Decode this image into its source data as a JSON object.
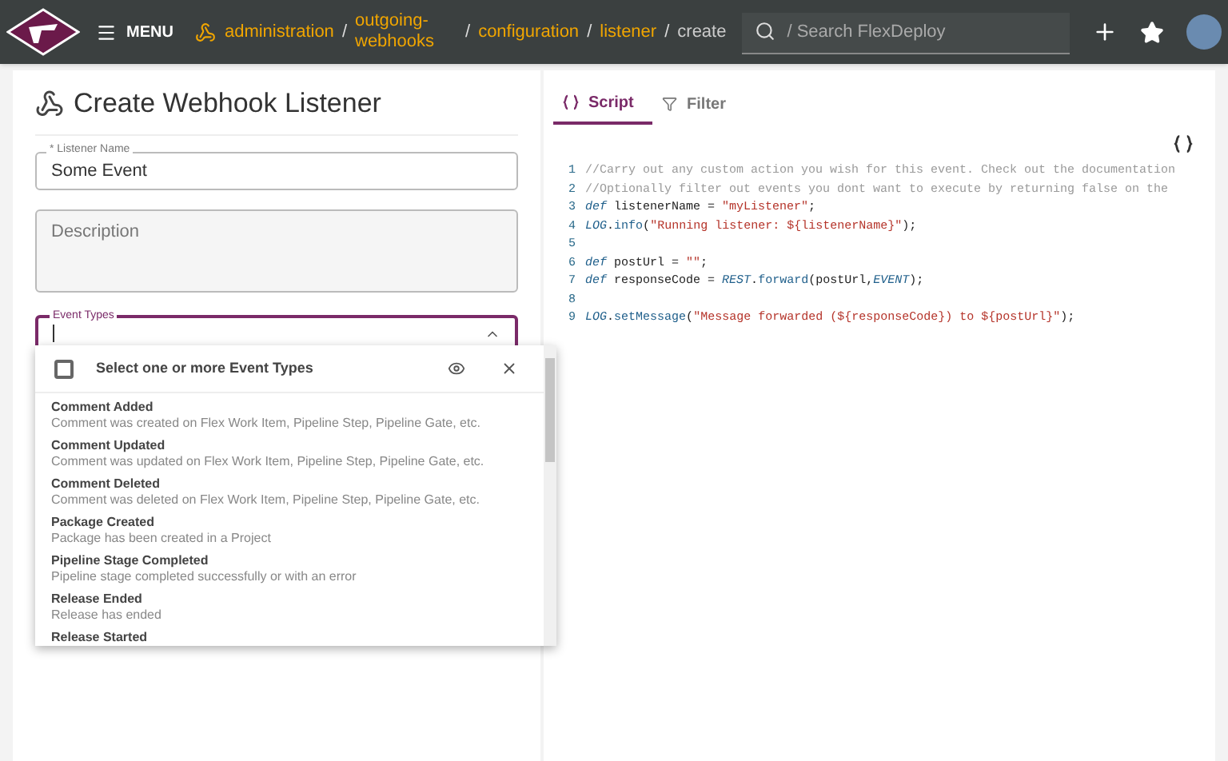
{
  "topbar": {
    "menu_label": "MENU",
    "separator": "/",
    "breadcrumbs": [
      {
        "label": "administration",
        "link": true
      },
      {
        "label": "outgoing-webhooks",
        "link": true
      },
      {
        "label": "configuration",
        "link": true
      },
      {
        "label": "listener",
        "link": true
      },
      {
        "label": "create",
        "link": false
      }
    ],
    "search": {
      "placeholder": "/ Search FlexDeploy"
    }
  },
  "page_title": "Create Webhook Listener",
  "form": {
    "listener_name": {
      "label": "* Listener Name",
      "value": "Some Event"
    },
    "description": {
      "placeholder": "Description"
    },
    "event_types": {
      "label": "Event Types",
      "focused": true
    }
  },
  "dropdown": {
    "select_all": {
      "label": "Select one or more Event Types",
      "checked": false
    },
    "options": [
      {
        "title": "Comment Added",
        "description": "Comment was created on Flex Work Item, Pipeline Step, Pipeline Gate, etc."
      },
      {
        "title": "Comment Updated",
        "description": "Comment was updated on Flex Work Item, Pipeline Step, Pipeline Gate, etc."
      },
      {
        "title": "Comment Deleted",
        "description": "Comment was deleted on Flex Work Item, Pipeline Step, Pipeline Gate, etc."
      },
      {
        "title": "Package Created",
        "description": "Package has been created in a Project"
      },
      {
        "title": "Pipeline Stage Completed",
        "description": "Pipeline stage completed successfully or with an error"
      },
      {
        "title": "Release Ended",
        "description": "Release has ended"
      },
      {
        "title": "Release Started"
      }
    ]
  },
  "tabs": [
    {
      "label": "Script",
      "selected": true
    },
    {
      "label": "Filter",
      "selected": false
    }
  ],
  "code": [
    {
      "number": "1",
      "tokens": [
        {
          "kind": "comment",
          "text": "//Carry out any custom action you wish for this event. Check out the documentation"
        }
      ]
    },
    {
      "number": "2",
      "tokens": [
        {
          "kind": "comment",
          "text": "//Optionally filter out events you dont want to execute by returning false on the"
        }
      ]
    },
    {
      "number": "3",
      "tokens": [
        {
          "kind": "keyword",
          "text": "def"
        },
        {
          "kind": "plain",
          "text": " listenerName = "
        },
        {
          "kind": "string",
          "text": "\"myListener\""
        },
        {
          "kind": "plain",
          "text": ";"
        }
      ]
    },
    {
      "number": "4",
      "tokens": [
        {
          "kind": "keyword",
          "text": "LOG"
        },
        {
          "kind": "plain",
          "text": "."
        },
        {
          "kind": "method",
          "text": "info"
        },
        {
          "kind": "plain",
          "text": "("
        },
        {
          "kind": "string",
          "text": "\"Running listener: ${listenerName}\""
        },
        {
          "kind": "plain",
          "text": ");"
        }
      ]
    },
    {
      "number": "5"
    },
    {
      "number": "6",
      "tokens": [
        {
          "kind": "keyword",
          "text": "def"
        },
        {
          "kind": "plain",
          "text": " postUrl = "
        },
        {
          "kind": "string",
          "text": "\"\""
        },
        {
          "kind": "plain",
          "text": ";"
        }
      ]
    },
    {
      "number": "7",
      "tokens": [
        {
          "kind": "keyword",
          "text": "def"
        },
        {
          "kind": "plain",
          "text": " responseCode = "
        },
        {
          "kind": "keyword",
          "text": "REST"
        },
        {
          "kind": "plain",
          "text": "."
        },
        {
          "kind": "method",
          "text": "forward"
        },
        {
          "kind": "plain",
          "text": "(postUrl,"
        },
        {
          "kind": "keyword",
          "text": "EVENT"
        },
        {
          "kind": "plain",
          "text": ");"
        }
      ]
    },
    {
      "number": "8"
    },
    {
      "number": "9",
      "tokens": [
        {
          "kind": "keyword",
          "text": "LOG"
        },
        {
          "kind": "plain",
          "text": "."
        },
        {
          "kind": "method",
          "text": "setMessage"
        },
        {
          "kind": "plain",
          "text": "("
        },
        {
          "kind": "string",
          "text": "\"Message forwarded (${responseCode}) to ${postUrl}\""
        },
        {
          "kind": "plain",
          "text": ");"
        }
      ]
    }
  ]
}
